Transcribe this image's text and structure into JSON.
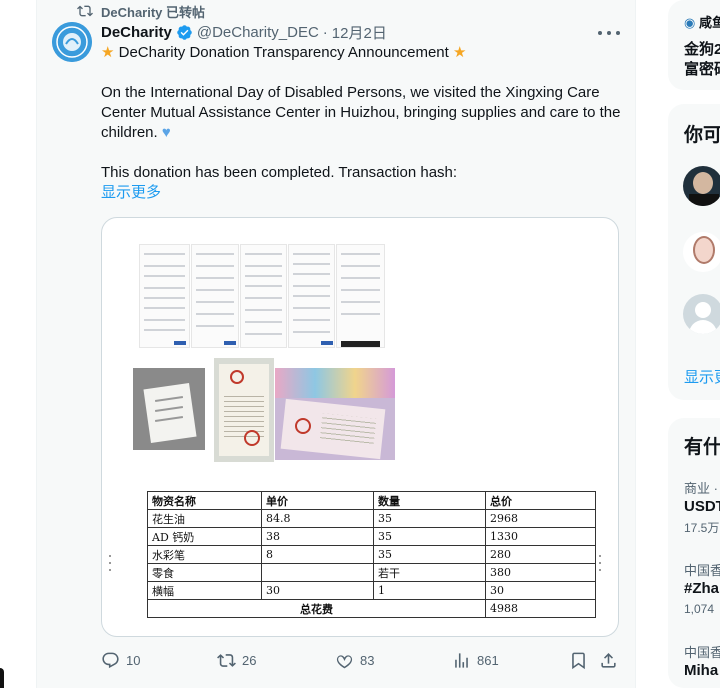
{
  "retweet": {
    "label": "DeCharity 已转帖"
  },
  "tweet": {
    "author_name": "DeCharity",
    "handle": "@DeCharity_DEC",
    "separator": "·",
    "date": "12月2日",
    "title_line": "DeCharity Donation Transparency Announcement",
    "paragraph1": "On the International Day of Disabled Persons, we visited the Xingxing Care Center Mutual Assistance Center in Huizhou, bringing supplies and care to the children.",
    "paragraph2": "This donation has been completed. Transaction hash:",
    "show_more": "显示更多"
  },
  "cost_table": {
    "headers": [
      "物资名称",
      "单价",
      "数量",
      "总价"
    ],
    "rows": [
      [
        "花生油",
        "84.8",
        "35",
        "2968"
      ],
      [
        "AD 钙奶",
        "38",
        "35",
        "1330"
      ],
      [
        "水彩笔",
        "8",
        "35",
        "280"
      ],
      [
        "零食",
        "",
        "若干",
        "380"
      ],
      [
        "横幅",
        "30",
        "1",
        "30"
      ]
    ],
    "total_label": "总花费",
    "total_value": "4988"
  },
  "actions": {
    "replies": "10",
    "reposts": "26",
    "likes": "83",
    "views": "861"
  },
  "sidebar": {
    "top_label": "咸鱼",
    "news_line1": "金狗2",
    "news_line2": "富密码",
    "who_to_follow_title": "你可",
    "show_more": "显示更",
    "trends_title": "有什",
    "trend1_category": "商业 ·",
    "trend1_name": "USDT",
    "trend1_count": "17.5万",
    "trend2_category": "中国香",
    "trend2_name": "#Zha",
    "trend2_count": "1,074 ",
    "trend3_category": "中国香",
    "trend3_name": "Miha"
  },
  "colors": {
    "accent": "#1d9bf0",
    "muted": "#536471",
    "star": "#f5a623",
    "heart": "#5ba4e6"
  }
}
